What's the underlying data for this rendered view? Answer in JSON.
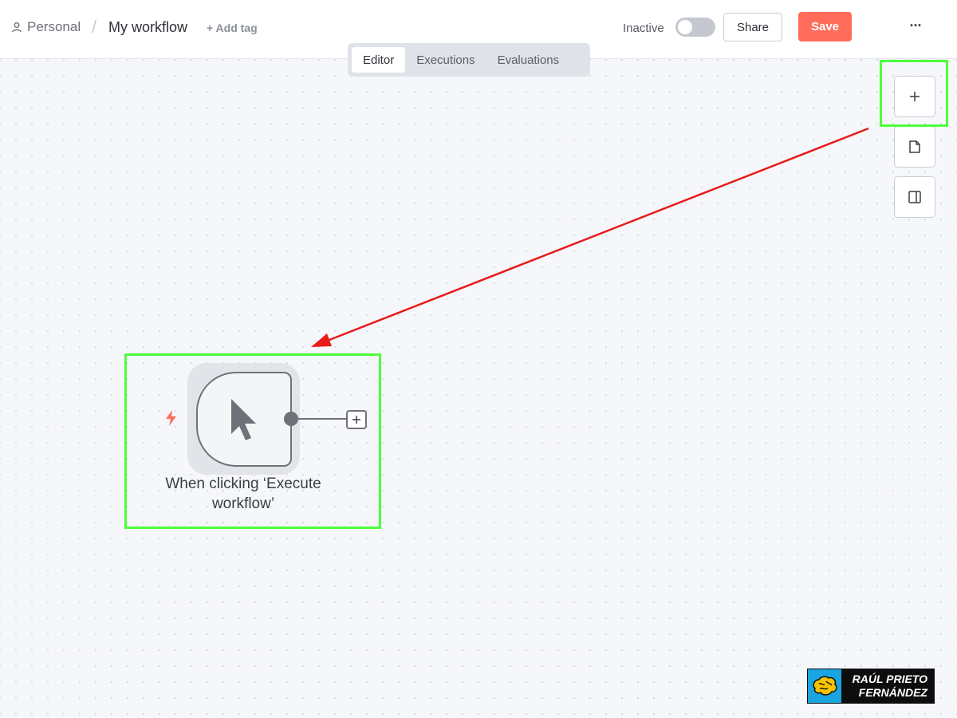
{
  "header": {
    "breadcrumb_project": "Personal",
    "breadcrumb_separator": "/",
    "workflow_title": "My workflow",
    "add_tag_label": "+ Add tag",
    "status_label": "Inactive",
    "active": false,
    "share_label": "Share",
    "save_label": "Save",
    "more_label": "···"
  },
  "tabs": [
    {
      "label": "Editor",
      "active": true
    },
    {
      "label": "Executions",
      "active": false
    },
    {
      "label": "Evaluations",
      "active": false
    }
  ],
  "side_toolbar": [
    "plus-icon",
    "sticky-note-icon",
    "panel-icon"
  ],
  "canvas": {
    "trigger_node": {
      "label": "When clicking ‘Execute workflow’",
      "icon": "cursor-icon",
      "trigger_icon": "lightning-icon"
    }
  },
  "watermark": {
    "line1": "RAÚL PRIETO",
    "line2": "FERNÁNDEZ"
  },
  "colors": {
    "accent": "#ff6d5a",
    "highlight": "#4cff3a",
    "arrow": "#e81b1b"
  }
}
